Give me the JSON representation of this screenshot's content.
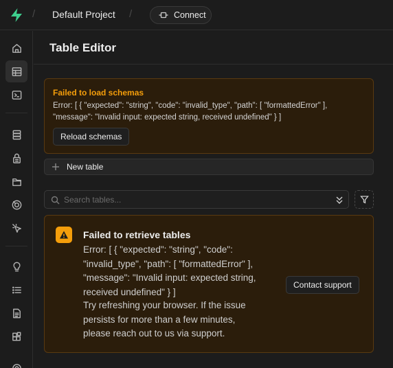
{
  "topbar": {
    "project_name": "Default Project",
    "connect_label": "Connect",
    "logo_icon": "supabase-logo",
    "brand_color": "#3ecf8e"
  },
  "sidebar": {
    "items": [
      {
        "icon": "home-icon",
        "active": false
      },
      {
        "icon": "table-icon",
        "active": true
      },
      {
        "icon": "terminal-icon",
        "active": false
      },
      {
        "icon": "database-icon",
        "active": false
      },
      {
        "icon": "lock-icon",
        "active": false
      },
      {
        "icon": "folder-icon",
        "active": false
      },
      {
        "icon": "realtime-icon",
        "active": false
      },
      {
        "icon": "pointer-icon",
        "active": false
      },
      {
        "icon": "lightbulb-icon",
        "active": false
      },
      {
        "icon": "list-icon",
        "active": false
      },
      {
        "icon": "document-icon",
        "active": false
      },
      {
        "icon": "extensions-icon",
        "active": false
      }
    ]
  },
  "page": {
    "title": "Table Editor"
  },
  "schema_error": {
    "title": "Failed to load schemas",
    "message": "Error: [ { \"expected\": \"string\", \"code\": \"invalid_type\", \"path\": [ \"formattedError\" ], \"message\": \"Invalid input: expected string, received undefined\" } ]",
    "button_label": "Reload schemas",
    "accent_color": "#f59e0b"
  },
  "new_table": {
    "label": "New table"
  },
  "search": {
    "placeholder": "Search tables..."
  },
  "tables_error": {
    "title": "Failed to retrieve tables",
    "message": "Error: [ { \"expected\": \"string\", \"code\": \"invalid_type\", \"path\": [ \"formattedError\" ], \"message\": \"Invalid input: expected string, received undefined\" } ]",
    "hint": "Try refreshing your browser. If the issue persists for more than a few minutes, please reach out to us via support.",
    "button_label": "Contact support"
  }
}
